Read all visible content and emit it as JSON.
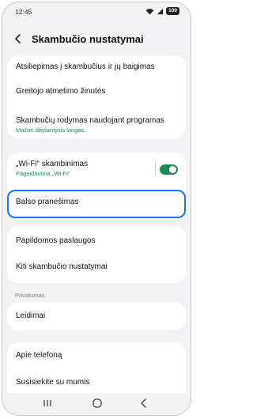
{
  "status": {
    "time": "12:45",
    "battery": "100"
  },
  "header": {
    "title": "Skambučio nustatymai"
  },
  "group1": [
    {
      "label": "Atsiliepimas į skambučius ir jų baigimas"
    },
    {
      "label": "Greitojo atmetimo žinutės"
    },
    {
      "label": "Skambučių rodymas naudojant programas",
      "sub": "Mažas iškylantysis langas."
    }
  ],
  "group2": {
    "wifi": {
      "label": "„Wi-Fi“ skambinimas",
      "sub": "Pageidautina „Wi-Fi“",
      "enabled": true
    },
    "voicemail": {
      "label": "Balso pranešimas"
    }
  },
  "group3": [
    {
      "label": "Papildomos paslaugos"
    },
    {
      "label": "Kiti skambučio nustatymai"
    }
  ],
  "privacy": {
    "section": "Privatumas",
    "permissions": "Leidimai"
  },
  "group4": [
    {
      "label": "Apie telefoną"
    },
    {
      "label": "Susisiekite su mumis"
    }
  ],
  "colors": {
    "accent": "#1f8a56",
    "highlight": "#1f73e8"
  },
  "icons": {
    "back": "chevron-left-icon",
    "recents": "recents-icon",
    "home": "home-icon",
    "back_nav": "back-nav-icon"
  }
}
